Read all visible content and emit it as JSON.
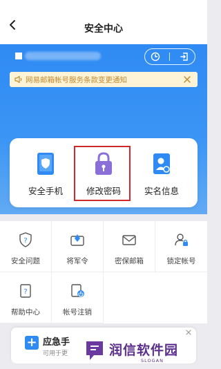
{
  "header": {
    "title": "安全中心"
  },
  "notice": {
    "text": "网易邮箱帐号服务条款变更通知"
  },
  "quick_actions": [
    {
      "label": "安全手机",
      "icon": "shield-phone-icon"
    },
    {
      "label": "修改密码",
      "icon": "lock-icon"
    },
    {
      "label": "实名信息",
      "icon": "id-card-icon"
    }
  ],
  "grid": [
    {
      "label": "安全问题",
      "icon": "question-shield-icon"
    },
    {
      "label": "将军令",
      "icon": "token-icon"
    },
    {
      "label": "密保邮箱",
      "icon": "mail-icon"
    },
    {
      "label": "锁定帐号",
      "icon": "user-lock-icon"
    },
    {
      "label": "帮助中心",
      "icon": "help-doc-icon"
    },
    {
      "label": "帐号注销",
      "icon": "account-cancel-icon"
    }
  ],
  "bottom_promo": {
    "title": "应急手",
    "subtitle": "可用于更"
  },
  "watermark": {
    "brand": "润信软件园",
    "slogan": "SLOGAN"
  },
  "colors": {
    "accent": "#2f8af3",
    "highlight": "#cf2a2a",
    "lock": "#8a6fd9"
  }
}
